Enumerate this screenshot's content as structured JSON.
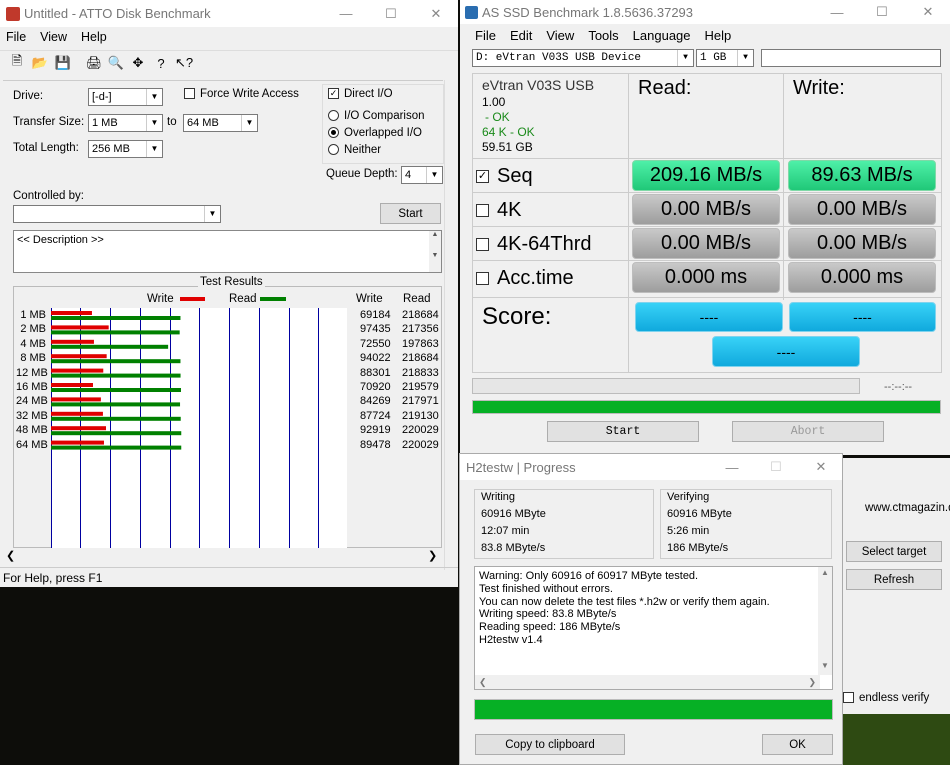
{
  "atto": {
    "title": "Untitled - ATTO Disk Benchmark",
    "menu": [
      "File",
      "View",
      "Help"
    ],
    "drive_label": "Drive:",
    "drive_value": "[-d-]",
    "transfer_label": "Transfer Size:",
    "transfer_from": "1 MB",
    "transfer_to_label": "to",
    "transfer_to": "64 MB",
    "length_label": "Total Length:",
    "length_value": "256 MB",
    "force_write": "Force Write Access",
    "direct_io": "Direct I/O",
    "io_comparison": "I/O Comparison",
    "overlapped": "Overlapped I/O",
    "neither": "Neither",
    "queue_label": "Queue Depth:",
    "queue_value": "4",
    "controlled_label": "Controlled by:",
    "start_label": "Start",
    "description": "<< Description >>",
    "results_title": "Test Results",
    "legend_write": "Write",
    "legend_read": "Read",
    "col_write": "Write",
    "col_read": "Read",
    "status": "For Help, press F1",
    "colors": {
      "write": "#e00000",
      "read": "#008000"
    },
    "rows": [
      {
        "size": "1 MB",
        "write": "69184",
        "read": "218684",
        "w": 69184,
        "r": 218684
      },
      {
        "size": "2 MB",
        "write": "97435",
        "read": "217356",
        "w": 97435,
        "r": 217356
      },
      {
        "size": "4 MB",
        "write": "72550",
        "read": "197863",
        "w": 72550,
        "r": 197863
      },
      {
        "size": "8 MB",
        "write": "94022",
        "read": "218684",
        "w": 94022,
        "r": 218684
      },
      {
        "size": "12 MB",
        "write": "88301",
        "read": "218833",
        "w": 88301,
        "r": 218833
      },
      {
        "size": "16 MB",
        "write": "70920",
        "read": "219579",
        "w": 70920,
        "r": 219579
      },
      {
        "size": "24 MB",
        "write": "84269",
        "read": "217971",
        "w": 84269,
        "r": 217971
      },
      {
        "size": "32 MB",
        "write": "87724",
        "read": "219130",
        "w": 87724,
        "r": 219130
      },
      {
        "size": "48 MB",
        "write": "92919",
        "read": "220029",
        "w": 92919,
        "r": 220029
      },
      {
        "size": "64 MB",
        "write": "89478",
        "read": "220029",
        "w": 89478,
        "r": 220029
      }
    ]
  },
  "asssd": {
    "title": "AS SSD Benchmark 1.8.5636.37293",
    "menu": [
      "File",
      "Edit",
      "View",
      "Tools",
      "Language",
      "Help"
    ],
    "device": "D: eVtran V03S USB Device",
    "size": "1 GB",
    "info_name": "eVtran V03S USB",
    "info_ver": "1.00",
    "info_ok1": "- OK",
    "info_ok2": "64 K - OK",
    "info_cap": "59.51 GB",
    "read_header": "Read:",
    "write_header": "Write:",
    "tests": [
      {
        "name": "Seq",
        "checked": "☑",
        "read": "209.16 MB/s",
        "write": "89.63 MB/s"
      },
      {
        "name": "4K",
        "checked": "",
        "read": "0.00 MB/s",
        "write": "0.00 MB/s"
      },
      {
        "name": "4K-64Thrd",
        "checked": "",
        "read": "0.00 MB/s",
        "write": "0.00 MB/s"
      },
      {
        "name": "Acc.time",
        "checked": "",
        "read": "0.000 ms",
        "write": "0.000 ms"
      }
    ],
    "score_label": "Score:",
    "score_read": "----",
    "score_write": "----",
    "score_total": "----",
    "time": "--:--:--",
    "start": "Start",
    "abort": "Abort"
  },
  "h2": {
    "title": "H2testw | Progress",
    "writing_label": "Writing",
    "writing_size": "60916 MByte",
    "writing_time": "12:07 min",
    "writing_speed": "83.8 MByte/s",
    "verifying_label": "Verifying",
    "verifying_size": "60916 MByte",
    "verifying_time": "5:26 min",
    "verifying_speed": "186 MByte/s",
    "log": [
      "Warning: Only 60916 of 60917 MByte tested.",
      "Test finished without errors.",
      "You can now delete the test files *.h2w or verify them again.",
      "Writing speed: 83.8 MByte/s",
      "Reading speed: 186 MByte/s",
      "H2testw v1.4"
    ],
    "progress": 1.0,
    "copy": "Copy to clipboard",
    "ok": "OK"
  },
  "behind": {
    "url": "www.ctmagazin.de",
    "select_target": "Select target",
    "refresh": "Refresh",
    "endless": "endless verify"
  }
}
